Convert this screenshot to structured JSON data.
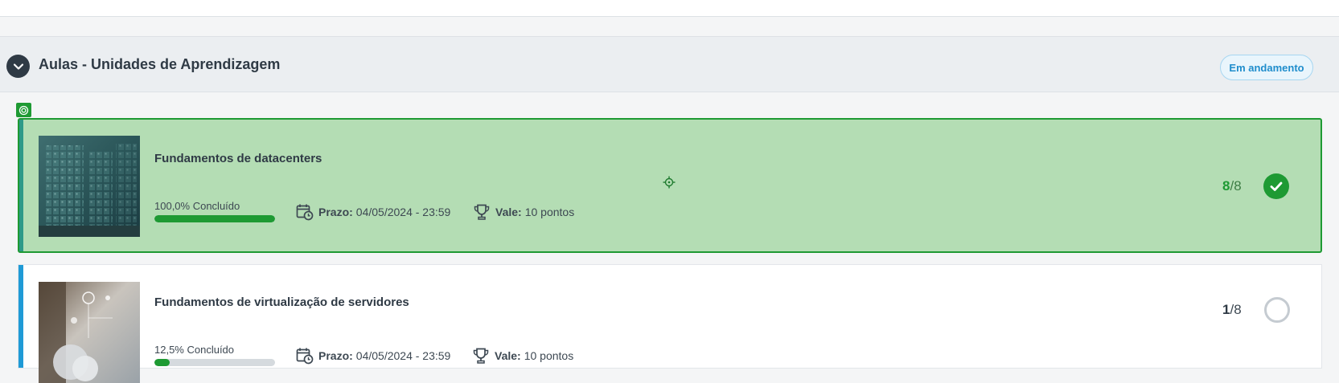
{
  "section": {
    "title": "Aulas - Unidades de Aprendizagem",
    "status": "Em andamento",
    "expanded": true
  },
  "lessons": [
    {
      "title": "Fundamentos de datacenters",
      "progress_label": "100,0% Concluído",
      "progress": 1.0,
      "deadline_label": "Prazo:",
      "deadline": "04/05/2024 - 23:59",
      "value_label": "Vale:",
      "value": "10 pontos",
      "completed": "8",
      "total": "/8",
      "status_icon": "check-circle-icon",
      "selected": true
    },
    {
      "title": "Fundamentos de virtualização de servidores",
      "progress_label": "12,5% Concluído",
      "progress": 0.125,
      "deadline_label": "Prazo:",
      "deadline": "04/05/2024 - 23:59",
      "value_label": "Vale:",
      "value": "10 pontos",
      "completed": "1",
      "total": "/8",
      "status_icon": "empty-circle-icon",
      "selected": false
    }
  ],
  "colors": {
    "accent_green": "#1e9a33",
    "selected_bg": "#b4ddb4",
    "badge_blue": "#1f8dcc",
    "stripe_blue": "#1f9ad6"
  }
}
